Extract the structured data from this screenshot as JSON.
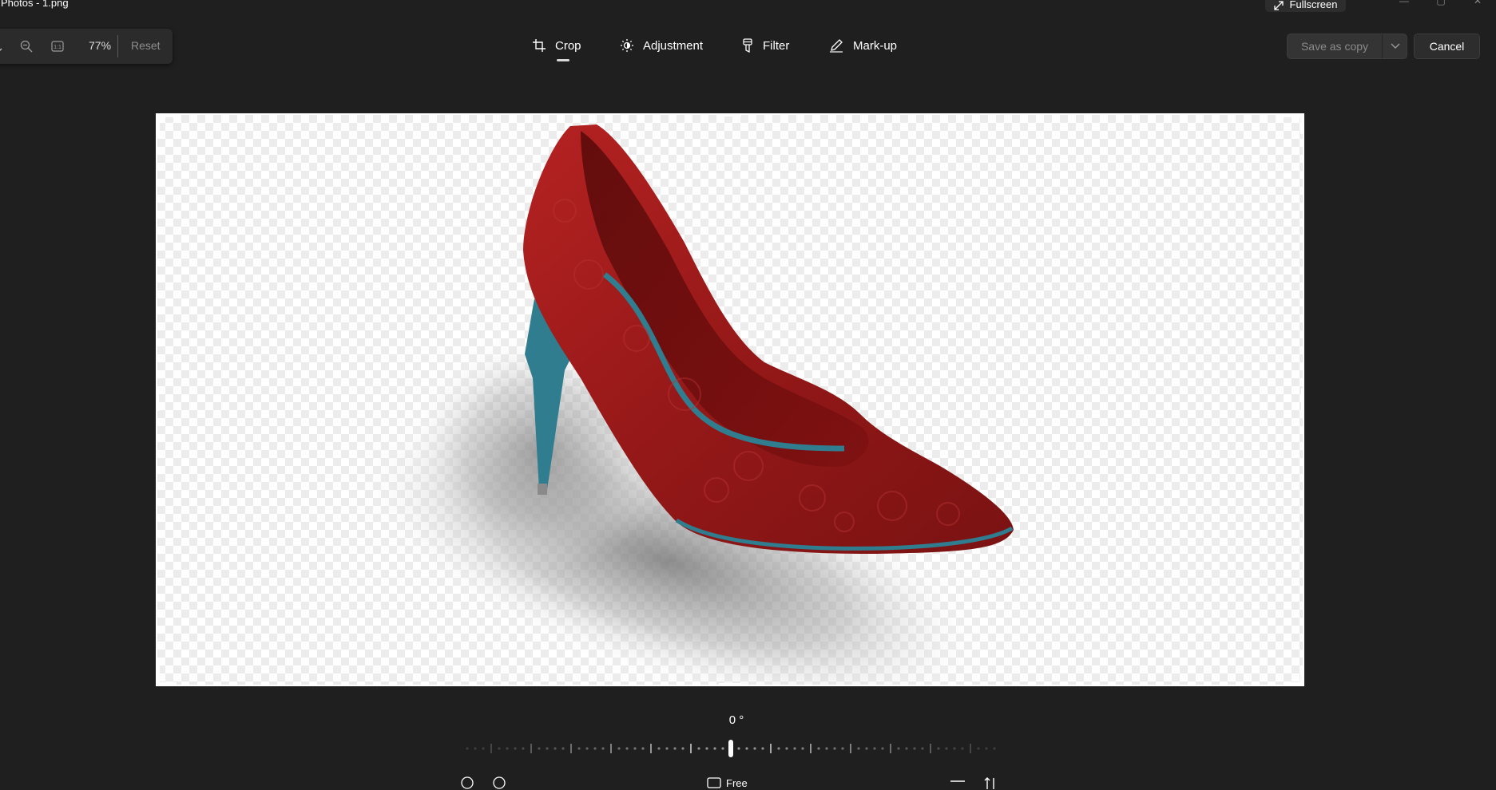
{
  "window": {
    "title": "Photos - 1.png",
    "fullscreen_label": "Fullscreen"
  },
  "zoom": {
    "value": "77%",
    "reset_label": "Reset"
  },
  "toolbar": {
    "tabs": [
      {
        "label": "Crop",
        "icon": "crop-icon",
        "active": true
      },
      {
        "label": "Adjustment",
        "icon": "brightness-icon",
        "active": false
      },
      {
        "label": "Filter",
        "icon": "filter-icon",
        "active": false
      },
      {
        "label": "Mark-up",
        "icon": "pen-icon",
        "active": false
      }
    ]
  },
  "actions": {
    "save_label": "Save as copy",
    "cancel_label": "Cancel"
  },
  "rotation": {
    "value": "0 °"
  },
  "bottom": {
    "aspect_label": "Free"
  },
  "colors": {
    "background": "#1f1f1f",
    "panel": "#2b2b2b",
    "shoe": "#9e1a1a",
    "heel": "#2f7d8f"
  }
}
